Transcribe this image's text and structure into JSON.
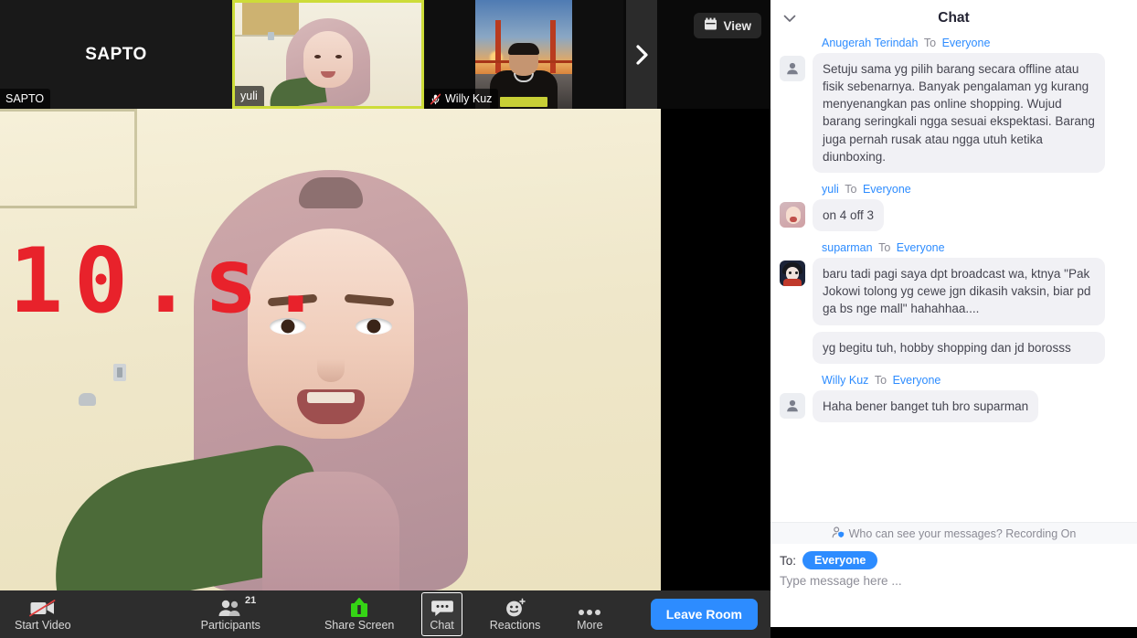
{
  "meeting": {
    "thumbnails": [
      {
        "name": "SAPTO",
        "center_label": "SAPTO",
        "muted": false,
        "active_speaker": false,
        "video_off": true
      },
      {
        "name": "yuli",
        "center_label": "",
        "muted": false,
        "active_speaker": true,
        "video_off": false
      },
      {
        "name": "Willy Kuz",
        "center_label": "",
        "muted": true,
        "active_speaker": false,
        "video_off": false
      }
    ],
    "next_arrow_icon": "chevron-right-icon",
    "view_button": {
      "label": "View",
      "icon": "grid-view-icon"
    },
    "overlay_text": "10.s.",
    "overlay_color": "#e8222b"
  },
  "toolbar": {
    "items": [
      {
        "label": "Start Video",
        "icon": "video-off-icon",
        "badge": "",
        "active": false
      },
      {
        "label": "Participants",
        "icon": "participants-icon",
        "badge": "21",
        "active": false
      },
      {
        "label": "Share Screen",
        "icon": "share-screen-icon",
        "badge": "",
        "active": false
      },
      {
        "label": "Chat",
        "icon": "chat-icon",
        "badge": "",
        "active": true
      },
      {
        "label": "Reactions",
        "icon": "reactions-icon",
        "badge": "",
        "active": false
      },
      {
        "label": "More",
        "icon": "more-dots-icon",
        "badge": "",
        "active": false
      }
    ],
    "leave_label": "Leave Room",
    "leave_color": "#2d8cff",
    "share_icon_color": "#35d415"
  },
  "chat": {
    "title": "Chat",
    "collapse_icon": "chevron-down-icon",
    "to_word": "To",
    "everyone": "Everyone",
    "messages": [
      {
        "sender": "Anugerah Terindah",
        "target": "Everyone",
        "avatar": "default",
        "bubbles": [
          "Setuju sama yg pilih barang secara offline atau fisik sebenarnya. Banyak pengalaman yg kurang menyenangkan pas online shopping. Wujud barang seringkali ngga sesuai ekspektasi. Barang juga pernah rusak atau ngga utuh ketika diunboxing."
        ]
      },
      {
        "sender": "yuli",
        "target": "Everyone",
        "avatar": "yuli",
        "bubbles": [
          "on 4 off 3"
        ]
      },
      {
        "sender": "suparman",
        "target": "Everyone",
        "avatar": "suparman",
        "bubbles": [
          "baru tadi pagi saya dpt broadcast wa, ktnya  \"Pak Jokowi tolong yg cewe jgn dikasih vaksin, biar pd ga bs nge mall\"  hahahhaa....",
          "yg begitu tuh, hobby shopping dan jd borosss"
        ]
      },
      {
        "sender": "Willy Kuz",
        "target": "Everyone",
        "avatar": "default",
        "bubbles": [
          "Haha bener banget tuh bro suparman"
        ]
      }
    ],
    "privacy_notice": "Who can see your messages? Recording On",
    "privacy_icon": "person-shield-icon",
    "compose": {
      "to_label": "To:",
      "to_chip": "Everyone",
      "placeholder": "Type message here ..."
    }
  },
  "colors": {
    "accent_blue": "#2d8cff",
    "bubble_bg": "#f1f1f5",
    "active_border": "#cddc39",
    "toolbar_bg": "#2d2d2d"
  }
}
